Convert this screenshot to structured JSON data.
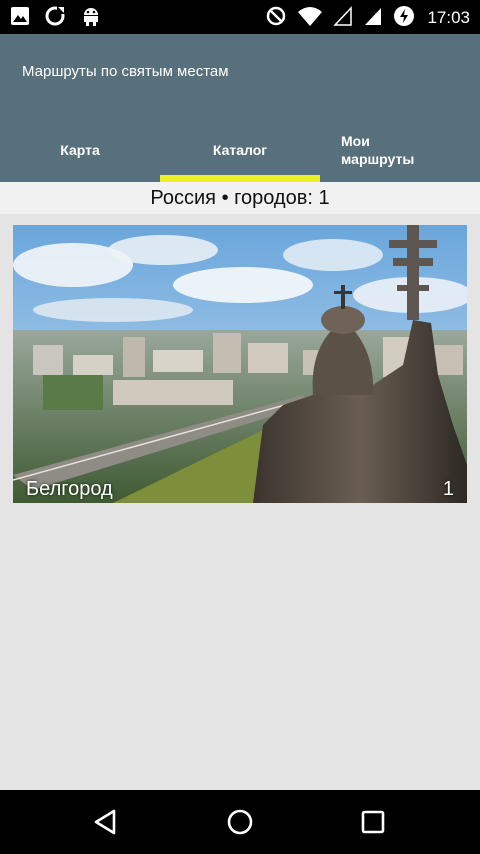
{
  "status_bar": {
    "time": "17:03",
    "left_icons": [
      "image-icon",
      "sync-icon",
      "android-debug-icon"
    ],
    "right_icons": [
      "do-not-disturb-icon",
      "wifi-icon",
      "signal-empty-icon",
      "signal-icon",
      "battery-charging-icon"
    ]
  },
  "app_bar": {
    "title": "Маршруты по святым местам",
    "tabs": [
      {
        "label": "Карта",
        "selected": false
      },
      {
        "label": "Каталог",
        "selected": true
      },
      {
        "label": "Мои маршруты",
        "selected": false
      }
    ],
    "indicator_color": "#e9f02a",
    "background_color": "#58707c"
  },
  "summary": {
    "text": "Россия • городов: 1"
  },
  "cards": [
    {
      "name": "Белгород",
      "count": "1"
    }
  ],
  "nav_bar": {
    "buttons": [
      "back-icon",
      "home-icon",
      "recents-icon"
    ]
  }
}
